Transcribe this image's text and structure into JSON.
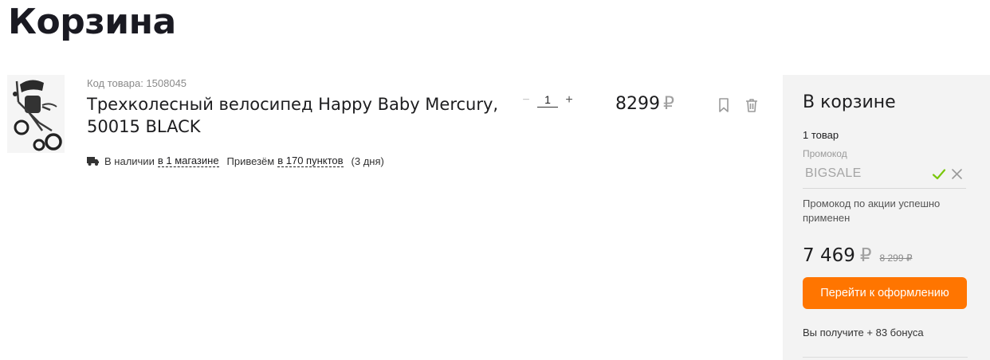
{
  "page": {
    "title": "Корзина"
  },
  "cart_item": {
    "image_alt": "tricycle",
    "sku_label": "Код товара: 1508045",
    "name": "Трехколесный велосипед Happy Baby Mercury, 50015 BLACK",
    "availability": {
      "in_stock_text": "В наличии",
      "stores_link": "в 1 магазине",
      "delivery_text": "Привезём",
      "points_link": "в 170 пунктов",
      "days": "(3 дня)"
    },
    "quantity": {
      "minus": "−",
      "value": "1",
      "plus": "+"
    },
    "price": "8299",
    "currency": "₽",
    "icons": [
      "bookmark-icon",
      "trash-icon"
    ]
  },
  "summary": {
    "title": "В корзине",
    "count": "1 товар",
    "promo_label": "Промокод",
    "promo_code": "BIGSALE",
    "promo_message": "Промокод по акции успешно применен",
    "total": "7 469",
    "currency": "₽",
    "old_total": "8 299 ₽",
    "checkout_label": "Перейти к оформлению",
    "bonus": "Вы получите + 83 бонуса"
  },
  "colors": {
    "accent": "#ff7500",
    "success": "#7ac70c",
    "panel_bg": "#f3f3f3"
  }
}
